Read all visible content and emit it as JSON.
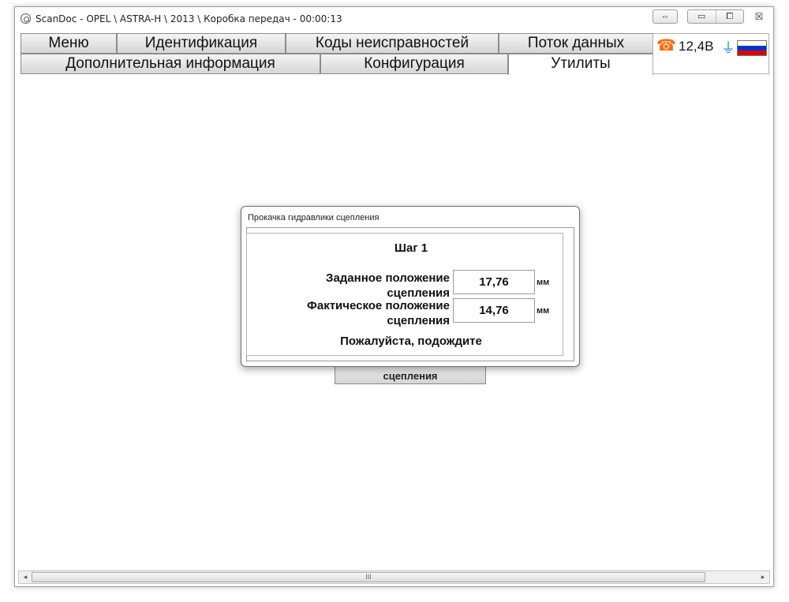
{
  "window": {
    "title": "ScanDoc - OPEL \\ ASTRA-H \\ 2013 \\ Коробка передач - 00:00:13",
    "resize_glyph": "⇔",
    "minimize_glyph": "▭",
    "maximize_glyph": "⧠",
    "close_glyph": "☒"
  },
  "tabs_row1": [
    {
      "label": "Меню"
    },
    {
      "label": "Идентификация"
    },
    {
      "label": "Коды неисправностей"
    },
    {
      "label": "Поток данных"
    }
  ],
  "tabs_row2": [
    {
      "label": "Дополнительная информация"
    },
    {
      "label": "Конфигурация"
    },
    {
      "label": "Утилиты",
      "active": true
    }
  ],
  "status": {
    "phone_icon": "☎",
    "voltage": "12,4В",
    "plug_icon": "⏚",
    "flag_colors": [
      "#ffffff",
      "#0033cc",
      "#dd0000"
    ]
  },
  "background_button": {
    "label": "сцепления"
  },
  "dialog": {
    "title": "Прокачка гидравлики сцепления",
    "step": "Шаг 1",
    "target_label": "Заданное положение сцепления",
    "target_value": "17,76",
    "actual_label": "Фактическое положение сцепления",
    "actual_value": "14,76",
    "unit": "мм",
    "status": "Пожалуйста, подождите"
  },
  "scrollbar": {
    "left_arrow": "◂",
    "right_arrow": "▸",
    "grip": "III"
  }
}
